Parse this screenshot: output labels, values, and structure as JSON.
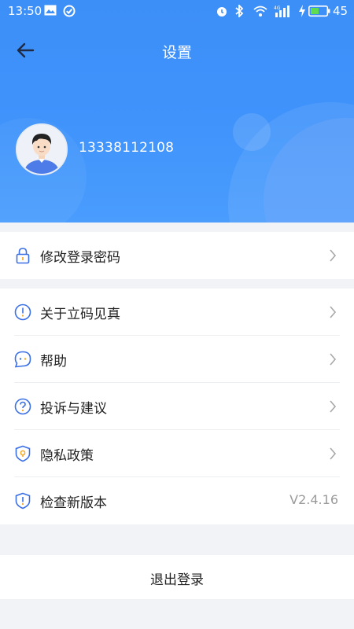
{
  "status_bar": {
    "time": "13:50",
    "battery_percent": "45",
    "network_label": "4G"
  },
  "header": {
    "title": "设置",
    "back_icon": "arrow-left-icon"
  },
  "profile": {
    "phone": "13338112108"
  },
  "sections": [
    [
      {
        "icon": "lock-icon",
        "label": "修改登录密码",
        "chevron": true
      }
    ],
    [
      {
        "icon": "info-icon",
        "label": "关于立码见真",
        "chevron": true
      },
      {
        "icon": "chat-icon",
        "label": "帮助",
        "chevron": true
      },
      {
        "icon": "question-icon",
        "label": "投诉与建议",
        "chevron": true
      },
      {
        "icon": "shield-location-icon",
        "label": "隐私政策",
        "chevron": true
      },
      {
        "icon": "shield-alert-icon",
        "label": "检查新版本",
        "value": "V2.4.16"
      }
    ]
  ],
  "logout_label": "退出登录",
  "colors": {
    "header_blue": "#3f93fb",
    "icon_blue": "#3a6fe6",
    "background": "#f2f3f7"
  }
}
